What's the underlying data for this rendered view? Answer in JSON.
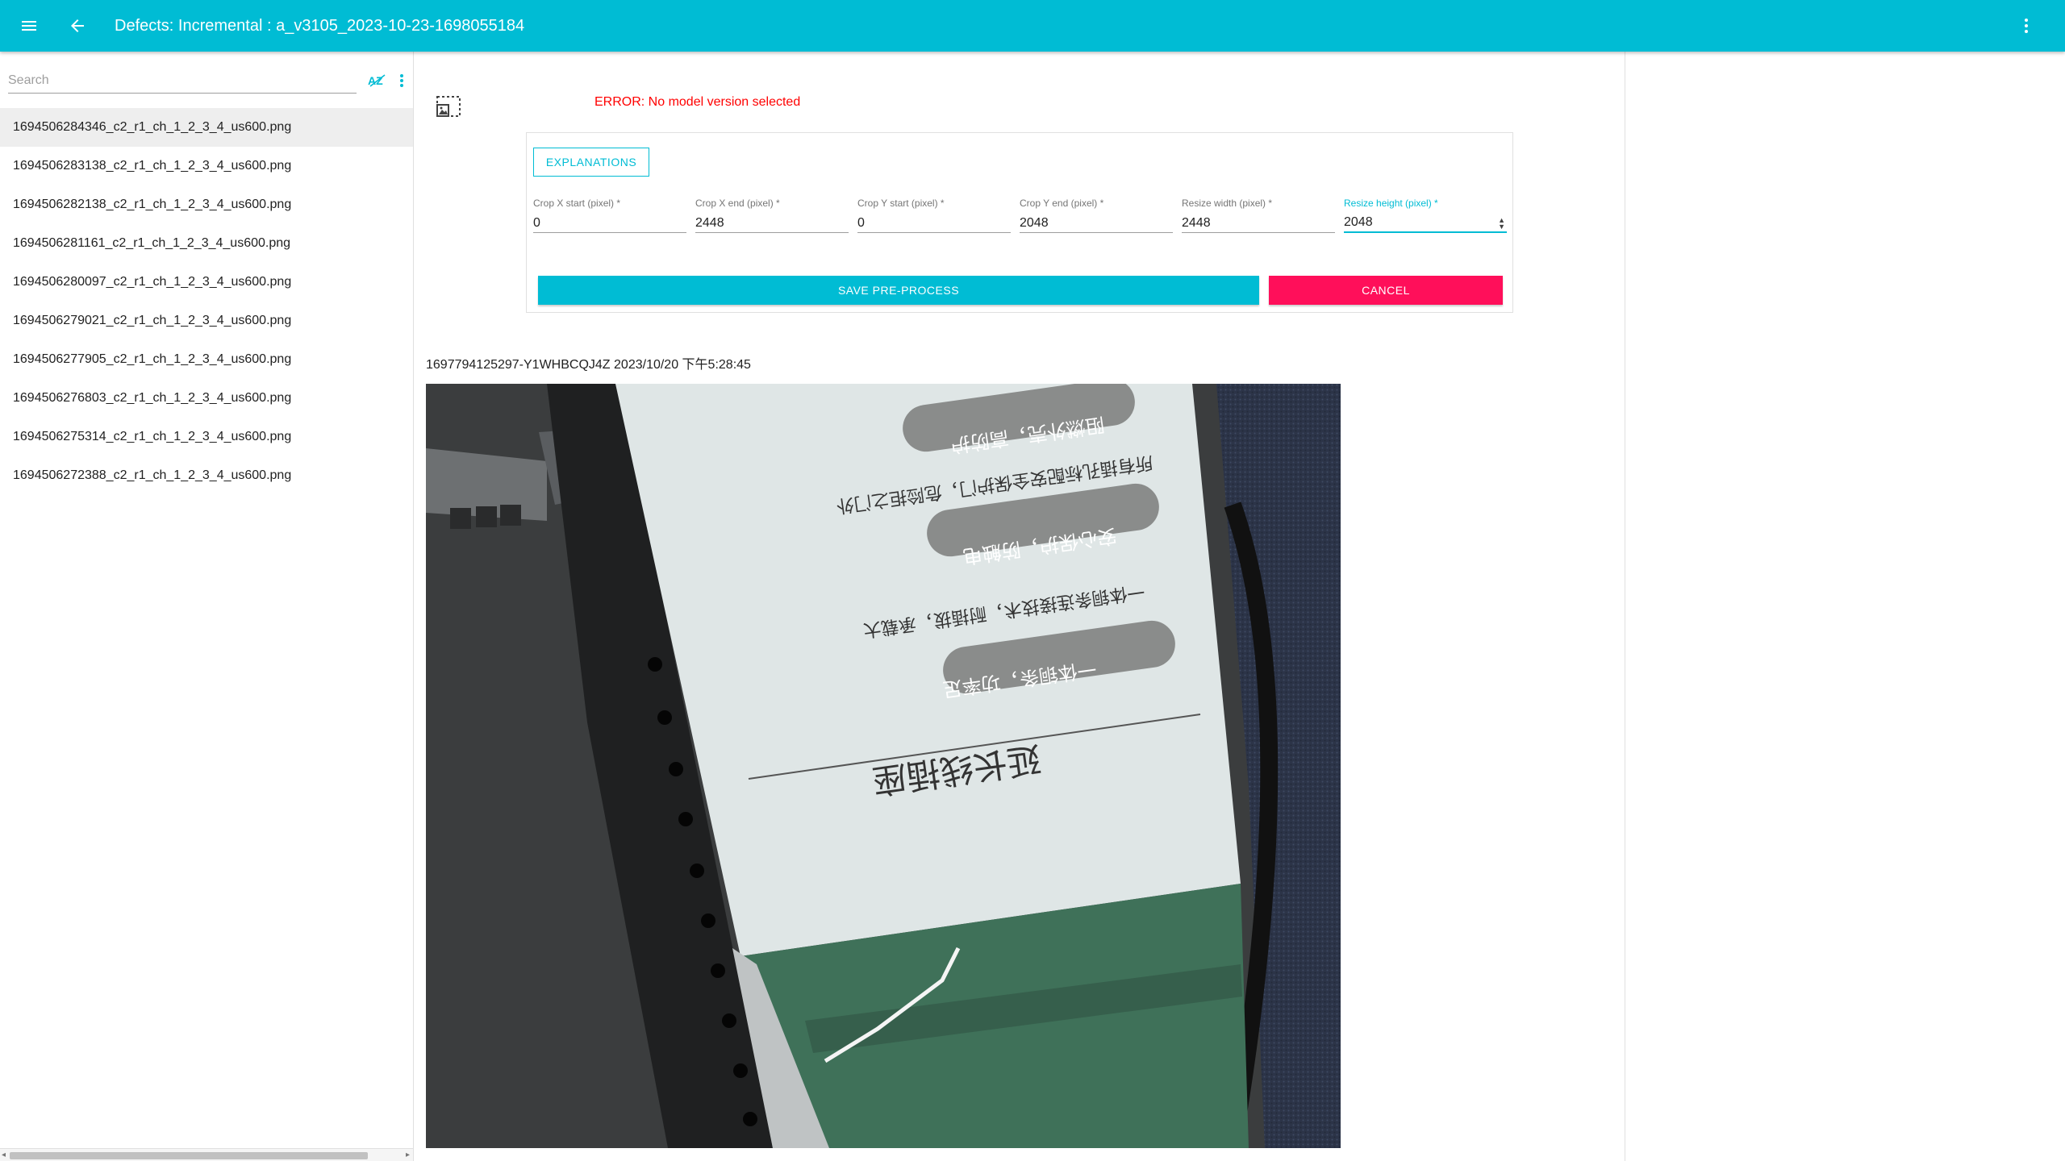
{
  "appbar": {
    "title": "Defects: Incremental : a_v3105_2023-10-23-1698055184"
  },
  "sidebar": {
    "search_placeholder": "Search",
    "sort_label": "AZ",
    "files": [
      "1694506284346_c2_r1_ch_1_2_3_4_us600.png",
      "1694506283138_c2_r1_ch_1_2_3_4_us600.png",
      "1694506282138_c2_r1_ch_1_2_3_4_us600.png",
      "1694506281161_c2_r1_ch_1_2_3_4_us600.png",
      "1694506280097_c2_r1_ch_1_2_3_4_us600.png",
      "1694506279021_c2_r1_ch_1_2_3_4_us600.png",
      "1694506277905_c2_r1_ch_1_2_3_4_us600.png",
      "1694506276803_c2_r1_ch_1_2_3_4_us600.png",
      "1694506275314_c2_r1_ch_1_2_3_4_us600.png",
      "1694506272388_c2_r1_ch_1_2_3_4_us600.png"
    ],
    "selected_index": 0
  },
  "main": {
    "error": "ERROR: No model version selected",
    "explanations_label": "EXPLANATIONS",
    "fields": [
      {
        "label": "Crop X start (pixel) *",
        "value": "0"
      },
      {
        "label": "Crop X end (pixel) *",
        "value": "2448"
      },
      {
        "label": "Crop Y start (pixel) *",
        "value": "0"
      },
      {
        "label": "Crop Y end (pixel) *",
        "value": "2048"
      },
      {
        "label": "Resize width (pixel) *",
        "value": "2448"
      },
      {
        "label": "Resize height (pixel) *",
        "value": "2048"
      }
    ],
    "save_label": "SAVE PRE-PROCESS",
    "cancel_label": "CANCEL",
    "image_caption": "1697794125297-Y1WHBCQJ4Z 2023/10/20 下午5:28:45",
    "image_texts": [
      "延长线插座",
      "一体铜条，功率足",
      "一体铜条连接技术，耐插拔，承载大",
      "安心保护，防触电",
      "所有插孔标配安全保护门，危险拒之门外",
      "阻燃外壳，高防护"
    ]
  },
  "colors": {
    "primary": "#00bcd4",
    "accent": "#ff0f5a",
    "error": "#ff0000"
  }
}
